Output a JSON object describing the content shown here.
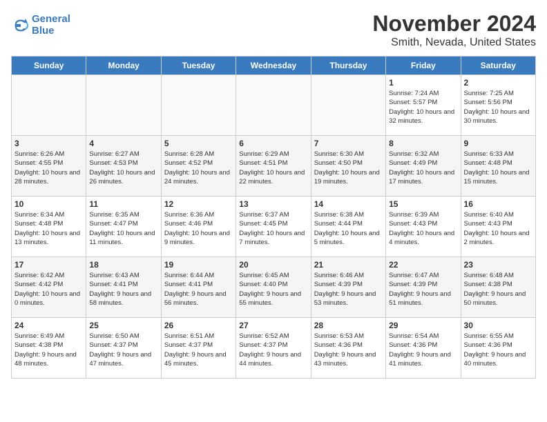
{
  "logo": {
    "line1": "General",
    "line2": "Blue"
  },
  "title": "November 2024",
  "subtitle": "Smith, Nevada, United States",
  "headers": [
    "Sunday",
    "Monday",
    "Tuesday",
    "Wednesday",
    "Thursday",
    "Friday",
    "Saturday"
  ],
  "weeks": [
    [
      {
        "day": "",
        "info": ""
      },
      {
        "day": "",
        "info": ""
      },
      {
        "day": "",
        "info": ""
      },
      {
        "day": "",
        "info": ""
      },
      {
        "day": "",
        "info": ""
      },
      {
        "day": "1",
        "info": "Sunrise: 7:24 AM\nSunset: 5:57 PM\nDaylight: 10 hours\nand 32 minutes."
      },
      {
        "day": "2",
        "info": "Sunrise: 7:25 AM\nSunset: 5:56 PM\nDaylight: 10 hours\nand 30 minutes."
      }
    ],
    [
      {
        "day": "3",
        "info": "Sunrise: 6:26 AM\nSunset: 4:55 PM\nDaylight: 10 hours\nand 28 minutes."
      },
      {
        "day": "4",
        "info": "Sunrise: 6:27 AM\nSunset: 4:53 PM\nDaylight: 10 hours\nand 26 minutes."
      },
      {
        "day": "5",
        "info": "Sunrise: 6:28 AM\nSunset: 4:52 PM\nDaylight: 10 hours\nand 24 minutes."
      },
      {
        "day": "6",
        "info": "Sunrise: 6:29 AM\nSunset: 4:51 PM\nDaylight: 10 hours\nand 22 minutes."
      },
      {
        "day": "7",
        "info": "Sunrise: 6:30 AM\nSunset: 4:50 PM\nDaylight: 10 hours\nand 19 minutes."
      },
      {
        "day": "8",
        "info": "Sunrise: 6:32 AM\nSunset: 4:49 PM\nDaylight: 10 hours\nand 17 minutes."
      },
      {
        "day": "9",
        "info": "Sunrise: 6:33 AM\nSunset: 4:48 PM\nDaylight: 10 hours\nand 15 minutes."
      }
    ],
    [
      {
        "day": "10",
        "info": "Sunrise: 6:34 AM\nSunset: 4:48 PM\nDaylight: 10 hours\nand 13 minutes."
      },
      {
        "day": "11",
        "info": "Sunrise: 6:35 AM\nSunset: 4:47 PM\nDaylight: 10 hours\nand 11 minutes."
      },
      {
        "day": "12",
        "info": "Sunrise: 6:36 AM\nSunset: 4:46 PM\nDaylight: 10 hours\nand 9 minutes."
      },
      {
        "day": "13",
        "info": "Sunrise: 6:37 AM\nSunset: 4:45 PM\nDaylight: 10 hours\nand 7 minutes."
      },
      {
        "day": "14",
        "info": "Sunrise: 6:38 AM\nSunset: 4:44 PM\nDaylight: 10 hours\nand 5 minutes."
      },
      {
        "day": "15",
        "info": "Sunrise: 6:39 AM\nSunset: 4:43 PM\nDaylight: 10 hours\nand 4 minutes."
      },
      {
        "day": "16",
        "info": "Sunrise: 6:40 AM\nSunset: 4:43 PM\nDaylight: 10 hours\nand 2 minutes."
      }
    ],
    [
      {
        "day": "17",
        "info": "Sunrise: 6:42 AM\nSunset: 4:42 PM\nDaylight: 10 hours\nand 0 minutes."
      },
      {
        "day": "18",
        "info": "Sunrise: 6:43 AM\nSunset: 4:41 PM\nDaylight: 9 hours\nand 58 minutes."
      },
      {
        "day": "19",
        "info": "Sunrise: 6:44 AM\nSunset: 4:41 PM\nDaylight: 9 hours\nand 56 minutes."
      },
      {
        "day": "20",
        "info": "Sunrise: 6:45 AM\nSunset: 4:40 PM\nDaylight: 9 hours\nand 55 minutes."
      },
      {
        "day": "21",
        "info": "Sunrise: 6:46 AM\nSunset: 4:39 PM\nDaylight: 9 hours\nand 53 minutes."
      },
      {
        "day": "22",
        "info": "Sunrise: 6:47 AM\nSunset: 4:39 PM\nDaylight: 9 hours\nand 51 minutes."
      },
      {
        "day": "23",
        "info": "Sunrise: 6:48 AM\nSunset: 4:38 PM\nDaylight: 9 hours\nand 50 minutes."
      }
    ],
    [
      {
        "day": "24",
        "info": "Sunrise: 6:49 AM\nSunset: 4:38 PM\nDaylight: 9 hours\nand 48 minutes."
      },
      {
        "day": "25",
        "info": "Sunrise: 6:50 AM\nSunset: 4:37 PM\nDaylight: 9 hours\nand 47 minutes."
      },
      {
        "day": "26",
        "info": "Sunrise: 6:51 AM\nSunset: 4:37 PM\nDaylight: 9 hours\nand 45 minutes."
      },
      {
        "day": "27",
        "info": "Sunrise: 6:52 AM\nSunset: 4:37 PM\nDaylight: 9 hours\nand 44 minutes."
      },
      {
        "day": "28",
        "info": "Sunrise: 6:53 AM\nSunset: 4:36 PM\nDaylight: 9 hours\nand 43 minutes."
      },
      {
        "day": "29",
        "info": "Sunrise: 6:54 AM\nSunset: 4:36 PM\nDaylight: 9 hours\nand 41 minutes."
      },
      {
        "day": "30",
        "info": "Sunrise: 6:55 AM\nSunset: 4:36 PM\nDaylight: 9 hours\nand 40 minutes."
      }
    ]
  ]
}
